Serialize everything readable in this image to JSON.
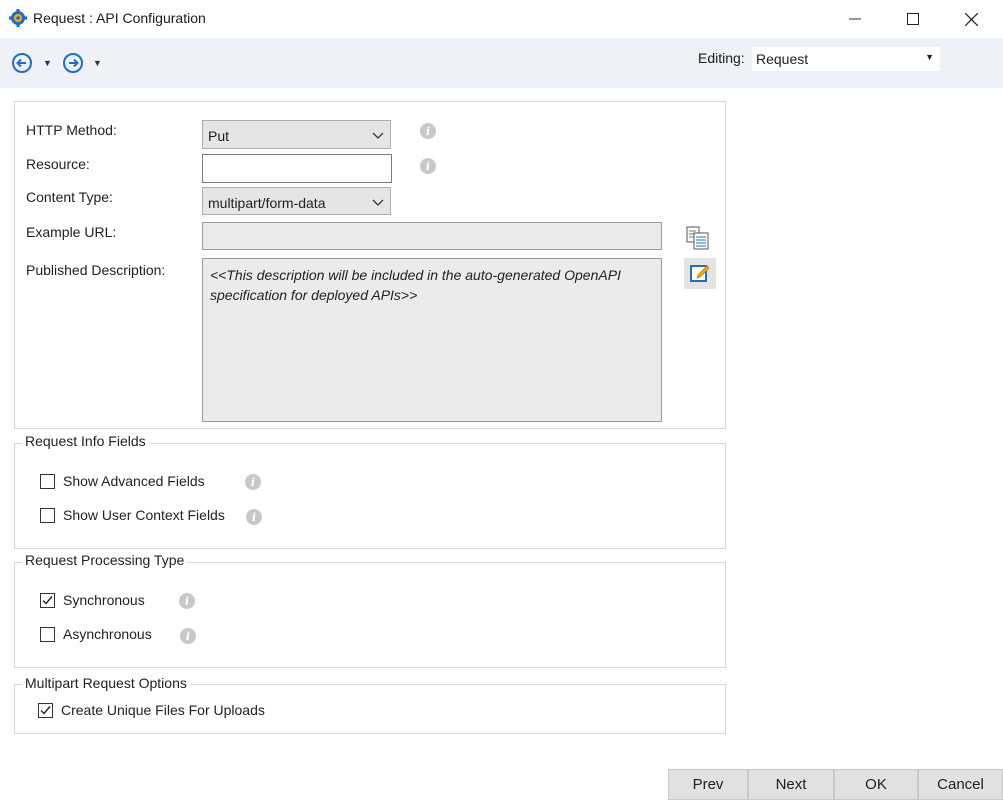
{
  "window": {
    "title": "Request : API Configuration"
  },
  "toolbar": {
    "editing_label": "Editing:",
    "editing_value": "Request"
  },
  "form": {
    "http_method_label": "HTTP Method:",
    "http_method_value": "Put",
    "resource_label": "Resource:",
    "resource_value": "",
    "content_type_label": "Content Type:",
    "content_type_value": "multipart/form-data",
    "example_url_label": "Example URL:",
    "example_url_value": "",
    "published_description_label": "Published Description:",
    "published_description_value": "<<This description will be included in the auto-generated OpenAPI specification for deployed APIs>>"
  },
  "request_info": {
    "legend": "Request Info Fields",
    "show_advanced": {
      "label": "Show Advanced Fields",
      "checked": false
    },
    "show_user_context": {
      "label": "Show User Context Fields",
      "checked": false
    }
  },
  "processing": {
    "legend": "Request Processing Type",
    "synchronous": {
      "label": "Synchronous",
      "checked": true
    },
    "asynchronous": {
      "label": "Asynchronous",
      "checked": false
    }
  },
  "multipart": {
    "legend": "Multipart Request Options",
    "unique_files": {
      "label": "Create Unique Files For Uploads",
      "checked": true
    }
  },
  "buttons": {
    "prev": "Prev",
    "next": "Next",
    "ok": "OK",
    "cancel": "Cancel"
  },
  "icons": {
    "app": "gear-icon",
    "back": "back-arrow-icon",
    "forward": "forward-arrow-icon",
    "info": "info-icon",
    "copy": "copy-icon",
    "edit": "edit-icon"
  },
  "colors": {
    "accent": "#1e6fc0",
    "toolbar_bg": "#eef2f7",
    "button_bg": "#e1e1e1",
    "readonly_bg": "#ebebeb"
  }
}
